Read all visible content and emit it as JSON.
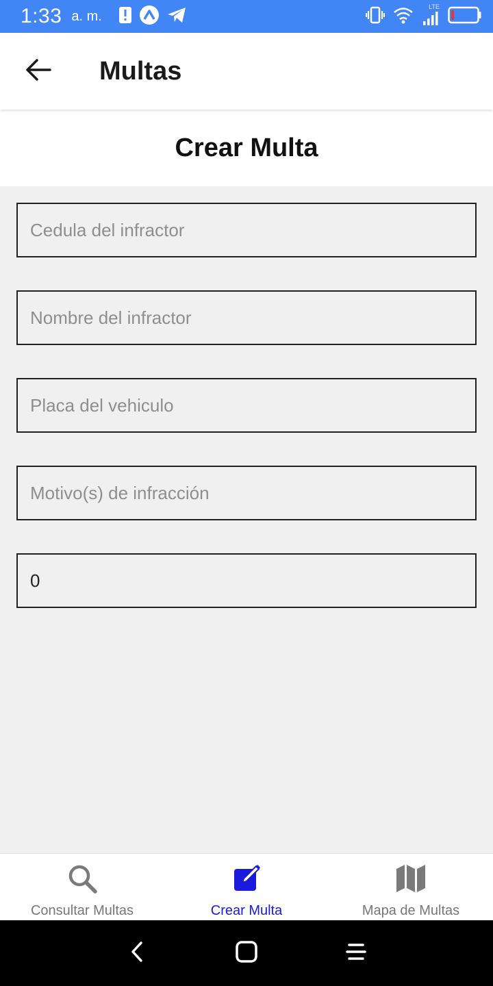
{
  "status_bar": {
    "time": "1:33",
    "ampm": "a. m.",
    "network_label": "LTE",
    "bg_color": "#4285f4"
  },
  "app_bar": {
    "title": "Multas",
    "back_icon": "arrow-left-icon"
  },
  "section": {
    "title": "Crear Multa"
  },
  "form": {
    "fields": [
      {
        "placeholder": "Cedula del infractor",
        "value": ""
      },
      {
        "placeholder": "Nombre del infractor",
        "value": ""
      },
      {
        "placeholder": "Placa del vehiculo",
        "value": ""
      },
      {
        "placeholder": "Motivo(s) de infracción",
        "value": ""
      },
      {
        "placeholder": "",
        "value": "0"
      }
    ]
  },
  "bottom_nav": {
    "active_color": "#1a1adb",
    "items": [
      {
        "label": "Consultar Multas",
        "icon": "search-icon",
        "active": false
      },
      {
        "label": "Crear Multa",
        "icon": "edit-icon",
        "active": true
      },
      {
        "label": "Mapa de Multas",
        "icon": "map-icon",
        "active": false
      }
    ]
  },
  "system_nav": {
    "icons": [
      "back-icon",
      "home-icon",
      "menu-icon"
    ]
  }
}
